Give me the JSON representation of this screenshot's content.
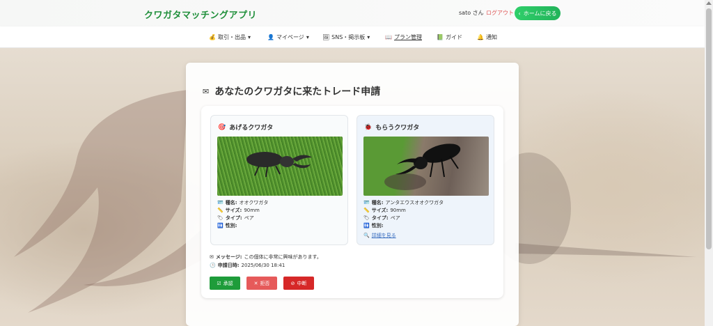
{
  "header": {
    "app_title": "クワガタマッチングアプリ",
    "user_label": "sato さん",
    "logout_label": "ログアウト",
    "home_button_label": "ホームに戻る",
    "home_icon": "chevron-left-icon"
  },
  "nav": {
    "items": [
      {
        "icon": "💰",
        "label": "取引・出品",
        "caret": "▾"
      },
      {
        "icon": "👤",
        "label": "マイページ",
        "caret": "▾"
      },
      {
        "icon": "🖼",
        "label": "SNS・掲示板",
        "caret": "▾"
      },
      {
        "icon": "📖",
        "label": "プラン管理",
        "caret": ""
      },
      {
        "icon": "📗",
        "label": "ガイド",
        "caret": ""
      },
      {
        "icon": "🔔",
        "label": "通知",
        "caret": ""
      }
    ],
    "active_index": 3
  },
  "trade": {
    "title_icon": "✉",
    "title": "あなたのクワガタに来たトレード申請",
    "give": {
      "icon": "🎯",
      "title": "あげるクワガタ",
      "species_label": "種名:",
      "species": "オオクワガタ",
      "size_label": "サイズ:",
      "size": "90mm",
      "type_label": "タイプ:",
      "type": "ペア",
      "sex_label": "性別:",
      "sex": ""
    },
    "receive": {
      "icon": "🐞",
      "title": "もらうクワガタ",
      "species_label": "種名:",
      "species": "アンタエウスオオクワガタ",
      "size_label": "サイズ:",
      "size": "90mm",
      "type_label": "タイプ:",
      "type": "ペア",
      "sex_label": "性別:",
      "sex": "",
      "detail_link": "詳細を見る"
    },
    "message_label": "メッセージ:",
    "message": "この個体に非常に興味があります。",
    "date_label": "申請日時:",
    "date": "2025/06/30 18:41",
    "buttons": {
      "approve": "承認",
      "reject": "拒否",
      "abort": "中断"
    }
  },
  "colors": {
    "brand": "#1f8f3a",
    "approve": "#1e9c3a",
    "reject": "#e65a5a",
    "abort": "#d62828",
    "logout": "#e05a5a",
    "link": "#3a6ec0"
  }
}
